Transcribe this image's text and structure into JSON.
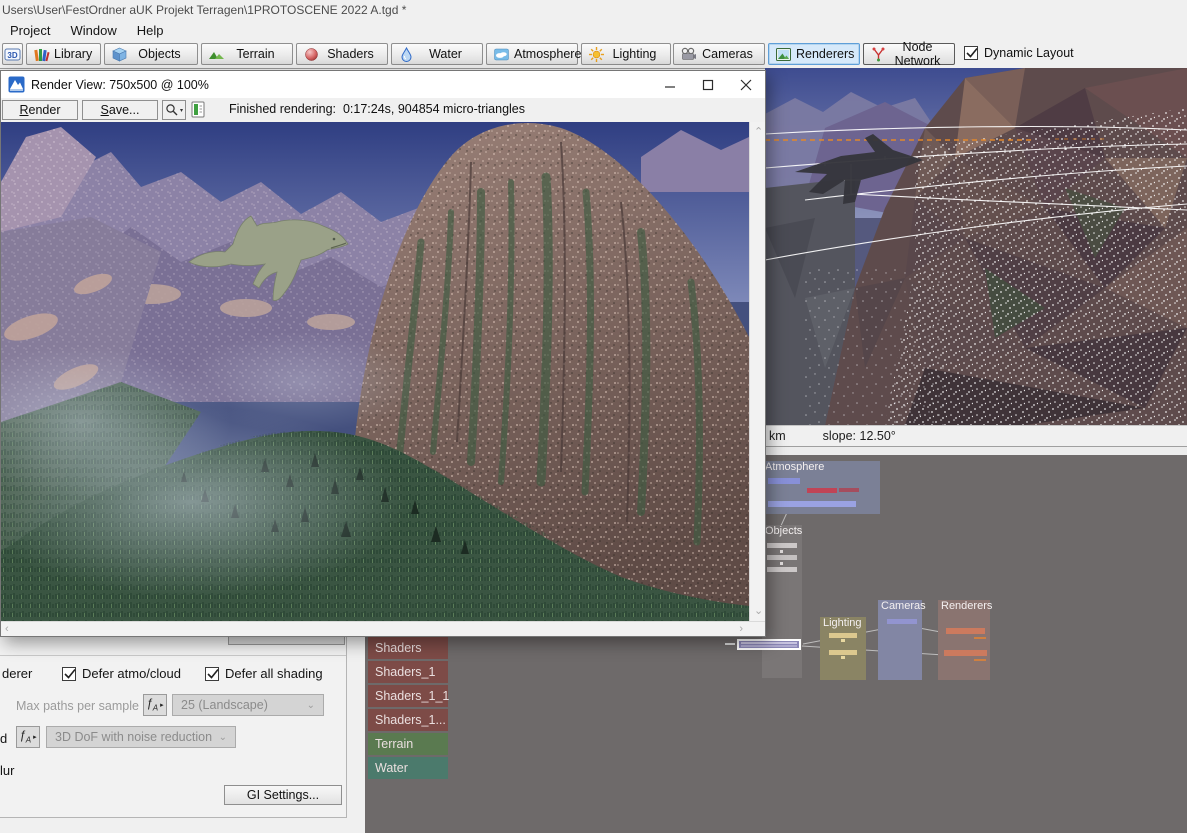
{
  "app": {
    "title": "Users\\User\\FestOrdner aUK Projekt Terragen\\1PROTOSCENE 2022 A.tgd *",
    "menu": [
      {
        "label": "Project"
      },
      {
        "label": "Window"
      },
      {
        "label": "Help"
      }
    ]
  },
  "toolbar": {
    "view3d_icon_text": "3D",
    "buttons": [
      {
        "label": "Library",
        "icon": "library-books-icon"
      },
      {
        "label": "Objects",
        "icon": "objects-cube-icon"
      },
      {
        "label": "Terrain",
        "icon": "terrain-icon"
      },
      {
        "label": "Shaders",
        "icon": "shaders-sphere-icon"
      },
      {
        "label": "Water",
        "icon": "water-drop-icon"
      },
      {
        "label": "Atmosphere",
        "icon": "atmosphere-cloud-icon"
      },
      {
        "label": "Lighting",
        "icon": "lighting-sun-icon"
      },
      {
        "label": "Cameras",
        "icon": "cameras-icon"
      },
      {
        "label": "Renderers",
        "icon": "renderers-image-icon",
        "active": true
      },
      {
        "label": "Node Network",
        "icon": "node-network-icon"
      }
    ],
    "dynamic_layout": {
      "label": "Dynamic Layout",
      "checked": true
    }
  },
  "render_view": {
    "title": "Render View: 750x500 @ 100%",
    "buttons": {
      "render": "Render",
      "save": "Save..."
    },
    "status": "Finished rendering:  0:17:24s, 904854 micro-triangles"
  },
  "preview": {
    "status_left": "km",
    "status_slope": "slope: 12.50°"
  },
  "render_settings": {
    "partial_renderer": "derer",
    "defer_atmo": "Defer atmo/cloud",
    "defer_all": "Defer all shading",
    "max_paths_label": "Max paths per sample",
    "max_paths_value": "25 (Landscape)",
    "partial_d": "d",
    "dof_value": "3D DoF with noise reduction",
    "partial_blur": "lur",
    "gi_button": "GI Settings..."
  },
  "node_list": [
    {
      "label": "Shaders",
      "color": "#7d4b47"
    },
    {
      "label": "Shaders_1",
      "color": "#7d4b47"
    },
    {
      "label": "Shaders_1_1",
      "color": "#7d4b47"
    },
    {
      "label": "Shaders_1...",
      "color": "#7d4b47"
    },
    {
      "label": "Terrain",
      "color": "#5a7a50"
    },
    {
      "label": "Water",
      "color": "#4b7a6c"
    }
  ],
  "node_network": {
    "groups": [
      {
        "label": "Atmosphere"
      },
      {
        "label": "Objects"
      },
      {
        "label": "Lighting"
      },
      {
        "label": "Cameras"
      },
      {
        "label": "Renderers"
      }
    ]
  },
  "colors": {
    "selection_accent": "#d6e9fa",
    "network_background": "#6e6a6a",
    "atmosphere_group": "#7b8096",
    "lighting_group": "#8a8464",
    "cameras_group": "#8286a4",
    "renderers_group": "#8a7470"
  }
}
